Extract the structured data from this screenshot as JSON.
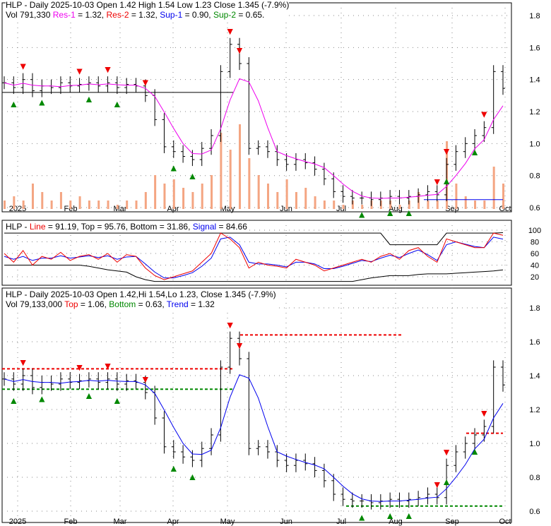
{
  "panel1": {
    "line1": "HLP - Daily 2025-10-03 Open 1.42  High 1.54  Low 1.23  Close 1.345 (-7.9%)",
    "vol": "Vol 791,330",
    "res1_label": "Res-1",
    "res1": "= 1.32,",
    "res2_label": "Res-2",
    "res2": "= 1.32,",
    "sup1_label": "Sup-1",
    "sup1": "= 0.90,",
    "sup2_label": "Sup-2",
    "sup2": "= 0.65."
  },
  "panel2": {
    "prefix": "HLP -",
    "line_label": "Line",
    "line": "= 91.19, Top = 95.76, Bottom = 31.86,",
    "signal_label": "Signal",
    "signal": "= 84.66"
  },
  "panel3": {
    "line1": "HLP - Daily 2025-10-03 Open 1.42,Hi 1.54,Lo 1.23, Close 1.345 (-7.9%)",
    "vol": "Vol 79,133,000",
    "top_label": "Top",
    "top": "= 1.06,",
    "bottom_label": "Bottom",
    "bottom": "= 0.63,",
    "trend_label": "Trend",
    "trend": "= 1.32"
  },
  "chart_data": {
    "type": "candlestick",
    "x_ticks": [
      "2025",
      "Feb",
      "Mar",
      "Apr",
      "May",
      "Jun",
      "Jul",
      "Aug",
      "Sep",
      "Oct"
    ],
    "price_ticks": [
      0.6,
      0.8,
      1.0,
      1.2,
      1.4,
      1.6,
      1.8
    ],
    "osc_ticks": [
      20,
      40,
      60,
      80,
      100
    ],
    "closes": [
      1.38,
      1.35,
      1.4,
      1.33,
      1.36,
      1.35,
      1.38,
      1.36,
      1.37,
      1.38,
      1.36,
      1.38,
      1.35,
      1.37,
      1.36,
      1.3,
      1.15,
      0.98,
      0.95,
      0.92,
      0.9,
      0.97,
      1.05,
      1.45,
      1.62,
      1.5,
      0.97,
      0.98,
      0.95,
      0.9,
      0.87,
      0.9,
      0.88,
      0.84,
      0.78,
      0.7,
      0.67,
      0.66,
      0.66,
      0.65,
      0.66,
      0.67,
      0.66,
      0.67,
      0.68,
      0.7,
      0.68,
      0.87,
      0.95,
      1.0,
      1.05,
      1.1,
      1.45,
      1.345
    ],
    "volume_rel": [
      0.1,
      0.15,
      0.1,
      0.3,
      0.2,
      0.1,
      0.2,
      0.1,
      0.15,
      0.1,
      0.1,
      0.1,
      0.05,
      0.1,
      0.1,
      0.2,
      0.4,
      0.3,
      0.35,
      0.25,
      0.2,
      0.3,
      0.4,
      0.9,
      0.7,
      1.0,
      0.6,
      0.4,
      0.3,
      0.2,
      0.35,
      0.2,
      0.25,
      0.15,
      0.1,
      0.1,
      0.05,
      0.1,
      0.05,
      0.1,
      0.1,
      0.1,
      0.05,
      0.1,
      0.2,
      0.1,
      0.1,
      0.8,
      0.3,
      0.15,
      0.1,
      0.1,
      0.5,
      0.3
    ],
    "osc_line": [
      60,
      45,
      65,
      40,
      55,
      50,
      62,
      48,
      55,
      58,
      50,
      60,
      45,
      58,
      55,
      35,
      22,
      15,
      20,
      25,
      30,
      45,
      60,
      95,
      85,
      70,
      35,
      45,
      40,
      38,
      35,
      50,
      45,
      40,
      30,
      35,
      40,
      45,
      50,
      45,
      55,
      60,
      50,
      65,
      70,
      55,
      45,
      85,
      80,
      75,
      70,
      70,
      95,
      91.19
    ],
    "osc_signal": [
      55,
      50,
      55,
      48,
      52,
      52,
      56,
      52,
      54,
      56,
      53,
      56,
      50,
      54,
      55,
      42,
      28,
      18,
      18,
      22,
      27,
      38,
      52,
      85,
      88,
      75,
      45,
      42,
      42,
      40,
      37,
      45,
      45,
      42,
      34,
      34,
      38,
      43,
      48,
      46,
      52,
      57,
      53,
      60,
      66,
      58,
      48,
      75,
      80,
      76,
      72,
      70,
      88,
      84.66
    ],
    "osc_top": [
      95,
      95,
      95,
      95,
      95,
      95,
      95,
      95,
      95,
      95,
      95,
      95,
      95,
      95,
      95,
      95,
      95,
      95,
      95,
      95,
      95,
      95,
      95,
      95,
      95,
      95,
      95,
      95,
      95,
      95,
      95,
      95,
      95,
      95,
      95,
      95,
      95,
      95,
      95,
      95,
      95,
      75,
      75,
      75,
      75,
      75,
      75,
      95,
      95,
      95,
      95,
      95,
      95,
      95.76
    ],
    "osc_bottom": [
      40,
      40,
      40,
      40,
      40,
      40,
      40,
      40,
      40,
      38,
      35,
      32,
      30,
      28,
      20,
      15,
      12,
      12,
      12,
      12,
      12,
      12,
      12,
      12,
      12,
      12,
      12,
      12,
      12,
      12,
      12,
      12,
      12,
      12,
      12,
      12,
      12,
      12,
      15,
      18,
      20,
      22,
      22,
      22,
      24,
      25,
      25,
      25,
      26,
      27,
      28,
      29,
      30,
      31.86
    ],
    "buy_signals": [
      1,
      4,
      9,
      12,
      18,
      20,
      38,
      41,
      43,
      47,
      50
    ],
    "sell_signals": [
      2,
      8,
      11,
      15,
      24,
      25,
      46,
      47,
      51
    ],
    "res_level": 1.32,
    "sup_level": 0.65,
    "top_level": 1.06,
    "bottom_level": 0.63
  }
}
